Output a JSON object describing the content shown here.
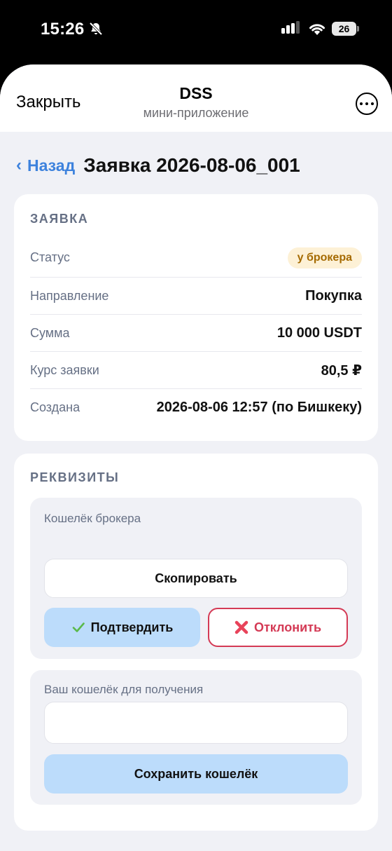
{
  "status_bar": {
    "time": "15:26",
    "battery": "26"
  },
  "header": {
    "close_label": "Закрыть",
    "title": "DSS",
    "subtitle": "мини-приложение"
  },
  "nav": {
    "back_label": "Назад",
    "page_title": "Заявка 2026-08-06_001"
  },
  "order_card": {
    "title": "ЗАЯВКА",
    "rows": [
      {
        "label": "Статус",
        "value": "у брокера"
      },
      {
        "label": "Направление",
        "value": "Покупка"
      },
      {
        "label": "Сумма",
        "value": "10 000 USDT"
      },
      {
        "label": "Курс заявки",
        "value": "80,5 ₽"
      },
      {
        "label": "Создана",
        "value": "2026-08-06 12:57 (по Бишкеку)"
      }
    ]
  },
  "requisites": {
    "title": "РЕКВИЗИТЫ",
    "broker_wallet_label": "Кошелёк брокера",
    "copy_button": "Скопировать",
    "confirm_button": "Подтвердить",
    "reject_button": "Отклонить",
    "your_wallet_label": "Ваш кошелёк для получения",
    "your_wallet_value": "",
    "save_button": "Сохранить кошелёк"
  },
  "colors": {
    "accent": "#3d82dd",
    "reject": "#d43a55",
    "primary_button": "#bcdcfb",
    "badge_bg": "#fdf1d6",
    "badge_text": "#a56a00"
  },
  "icons": {
    "confirm": "checkmark-icon",
    "reject": "cross-icon"
  }
}
